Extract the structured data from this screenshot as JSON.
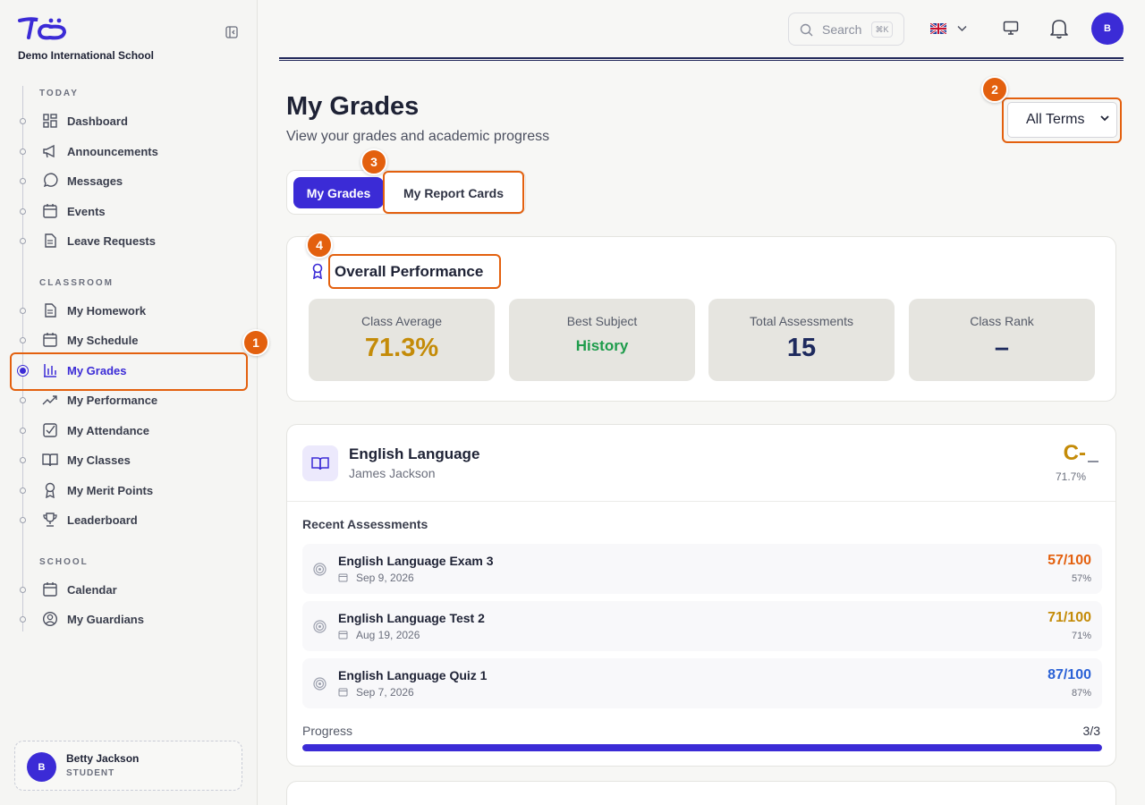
{
  "school": {
    "name": "Demo International School"
  },
  "sidebar": {
    "sections": [
      {
        "title": "TODAY",
        "items": [
          {
            "label": "Dashboard"
          },
          {
            "label": "Announcements"
          },
          {
            "label": "Messages"
          },
          {
            "label": "Events"
          },
          {
            "label": "Leave Requests"
          }
        ]
      },
      {
        "title": "CLASSROOM",
        "items": [
          {
            "label": "My Homework"
          },
          {
            "label": "My Schedule"
          },
          {
            "label": "My Grades"
          },
          {
            "label": "My Performance"
          },
          {
            "label": "My Attendance"
          },
          {
            "label": "My Classes"
          },
          {
            "label": "My Merit Points"
          },
          {
            "label": "Leaderboard"
          }
        ]
      },
      {
        "title": "SCHOOL",
        "items": [
          {
            "label": "Calendar"
          },
          {
            "label": "My Guardians"
          }
        ]
      }
    ],
    "active_item": "My Grades"
  },
  "user": {
    "initial": "B",
    "name": "Betty Jackson",
    "role": "STUDENT"
  },
  "topbar": {
    "search_placeholder": "Search",
    "search_shortcut": "⌘K",
    "avatar_initial": "B"
  },
  "page": {
    "title": "My Grades",
    "subtitle": "View your grades and academic progress",
    "term_select": "All Terms"
  },
  "tabs": [
    {
      "label": "My Grades",
      "active": true
    },
    {
      "label": "My Report Cards",
      "active": false
    }
  ],
  "annotations": [
    "1",
    "2",
    "3",
    "4"
  ],
  "overall": {
    "title": "Overall Performance",
    "stats": [
      {
        "label": "Class Average",
        "value": "71.3%",
        "color": "#c48b08"
      },
      {
        "label": "Best Subject",
        "value": "History",
        "color": "#1e9c4b"
      },
      {
        "label": "Total Assessments",
        "value": "15",
        "color": "#1e2a5e"
      },
      {
        "label": "Class Rank",
        "value": "–",
        "color": "#1e2a5e"
      }
    ]
  },
  "subject": {
    "name": "English Language",
    "teacher": "James Jackson",
    "grade": "C-",
    "percent": "71.7%",
    "recent_title": "Recent Assessments",
    "assessments": [
      {
        "name": "English Language Exam 3",
        "date": "Sep 9, 2026",
        "score": "57/100",
        "pct": "57%",
        "color": "#e3600e"
      },
      {
        "name": "English Language Test 2",
        "date": "Aug 19, 2026",
        "score": "71/100",
        "pct": "71%",
        "color": "#c48b08"
      },
      {
        "name": "English Language Quiz 1",
        "date": "Sep 7, 2026",
        "score": "87/100",
        "pct": "87%",
        "color": "#2b62d6"
      }
    ],
    "progress_label": "Progress",
    "progress_count": "3/3",
    "progress_fraction": 1.0
  }
}
